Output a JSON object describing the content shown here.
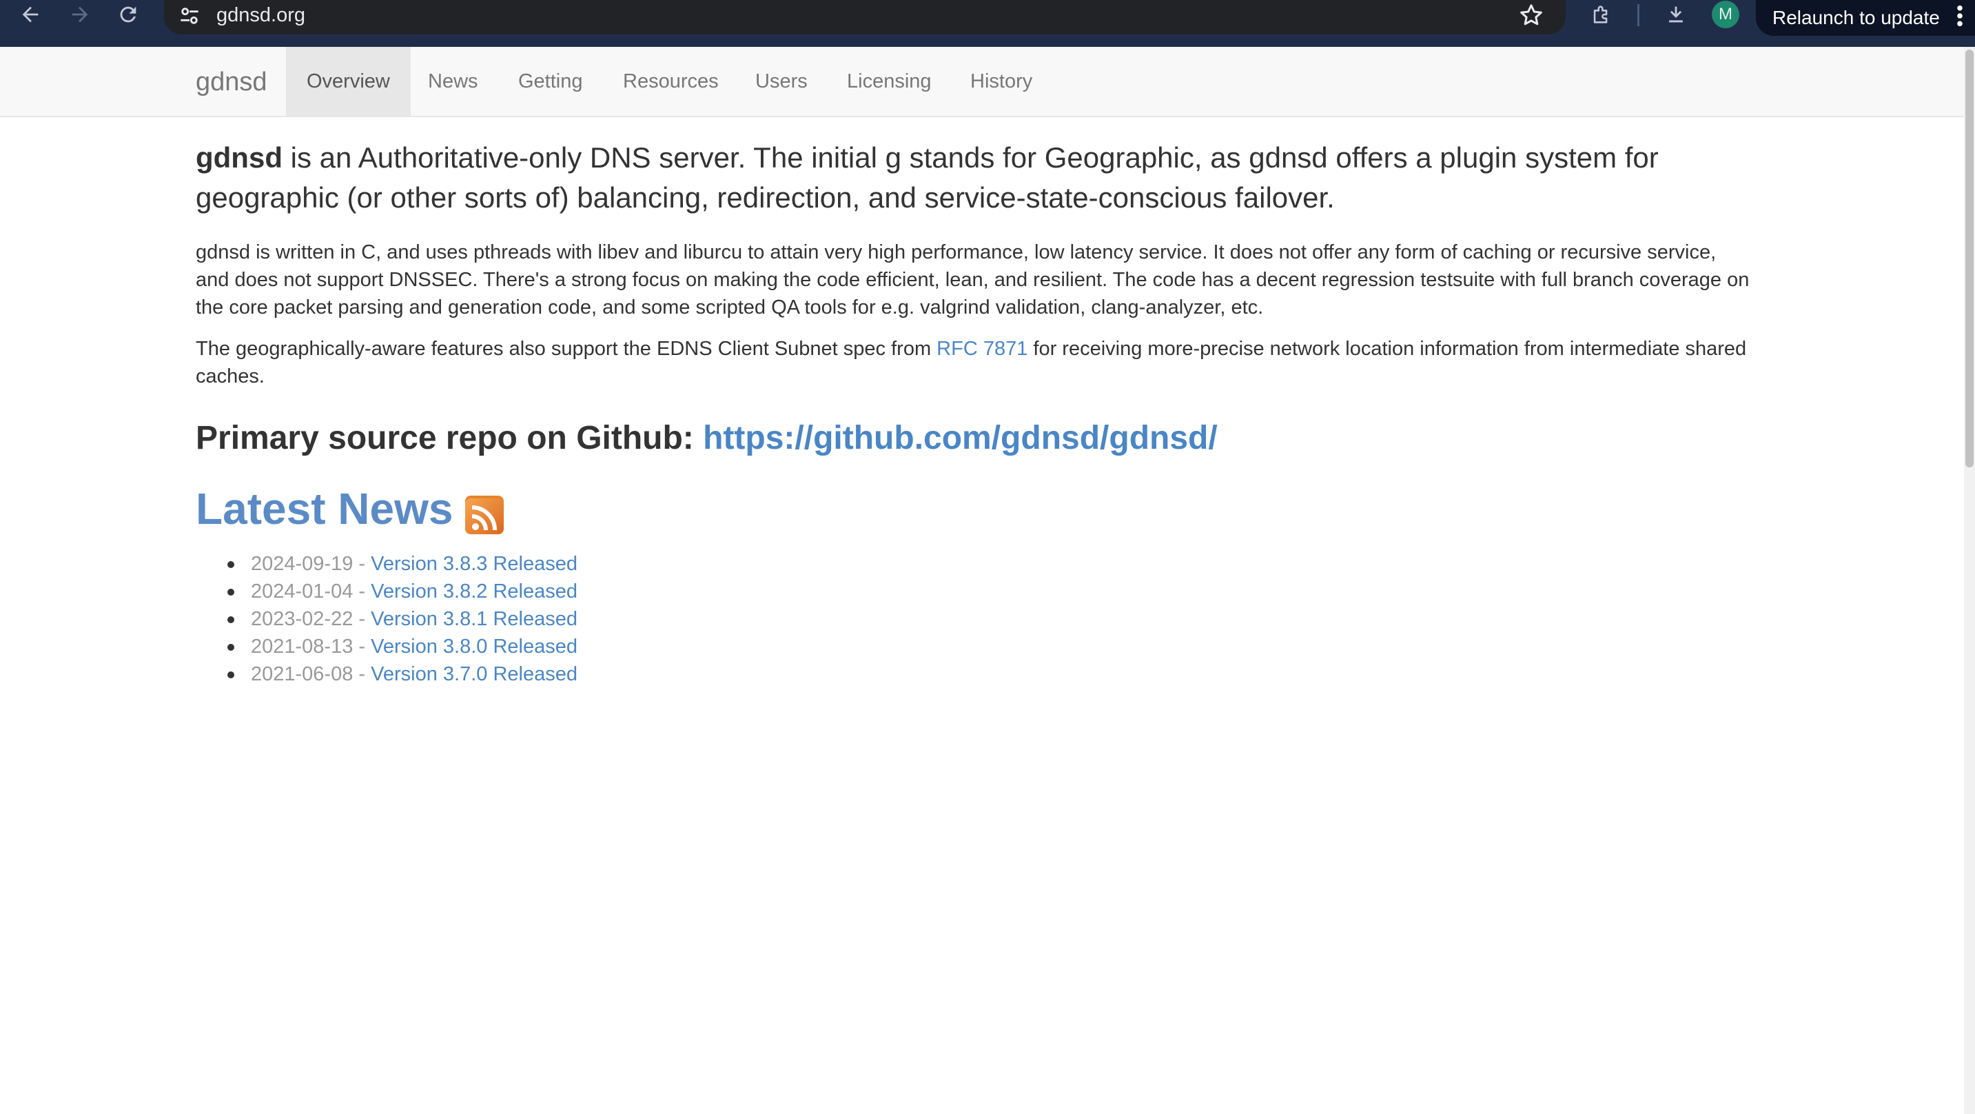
{
  "browser": {
    "url": "gdnsd.org",
    "profile_initial": "M",
    "relaunch_label": "Relaunch to update",
    "icons": [
      "back-arrow-icon",
      "forward-arrow-icon",
      "reload-icon",
      "site-settings-icon",
      "bookmark-star-icon",
      "extensions-icon",
      "download-icon",
      "more-vert-icon"
    ]
  },
  "navbar": {
    "brand": "gdnsd",
    "items": [
      {
        "label": "Overview",
        "active": true
      },
      {
        "label": "News",
        "active": false
      },
      {
        "label": "Getting",
        "active": false
      },
      {
        "label": "Resources",
        "active": false
      },
      {
        "label": "Users",
        "active": false
      },
      {
        "label": "Licensing",
        "active": false
      },
      {
        "label": "History",
        "active": false
      }
    ]
  },
  "content": {
    "lead_bold": "gdnsd",
    "lead_rest": " is an Authoritative-only DNS server. The initial g stands for Geographic, as gdnsd offers a plugin system for geographic (or other sorts of) balancing, redirection, and service-state-conscious failover.",
    "para1": "gdnsd is written in C, and uses pthreads with libev and liburcu to attain very high performance, low latency service. It does not offer any form of caching or recursive service, and does not support DNSSEC. There's a strong focus on making the code efficient, lean, and resilient. The code has a decent regression testsuite with full branch coverage on the core packet parsing and generation code, and some scripted QA tools for e.g. valgrind validation, clang-analyzer, etc.",
    "para2_before": "The geographically-aware features also support the EDNS Client Subnet spec from ",
    "para2_link": "RFC 7871",
    "para2_after": " for receiving more-precise network location information from intermediate shared caches.",
    "repo_label": "Primary source repo on Github: ",
    "repo_link": "https://github.com/gdnsd/gdnsd/",
    "news_heading": "Latest News",
    "news": [
      {
        "date": "2024-09-19 - ",
        "title": "Version 3.8.3 Released"
      },
      {
        "date": "2024-01-04 - ",
        "title": "Version 3.8.2 Released"
      },
      {
        "date": "2023-02-22 - ",
        "title": "Version 3.8.1 Released"
      },
      {
        "date": "2021-08-13 - ",
        "title": "Version 3.8.0 Released"
      },
      {
        "date": "2021-06-08 - ",
        "title": "Version 3.7.0 Released"
      }
    ]
  },
  "colors": {
    "chrome_bg": "#202d49",
    "link": "#4a86c6",
    "heading_news": "#5b8bc7",
    "rss": "#e8832a"
  }
}
